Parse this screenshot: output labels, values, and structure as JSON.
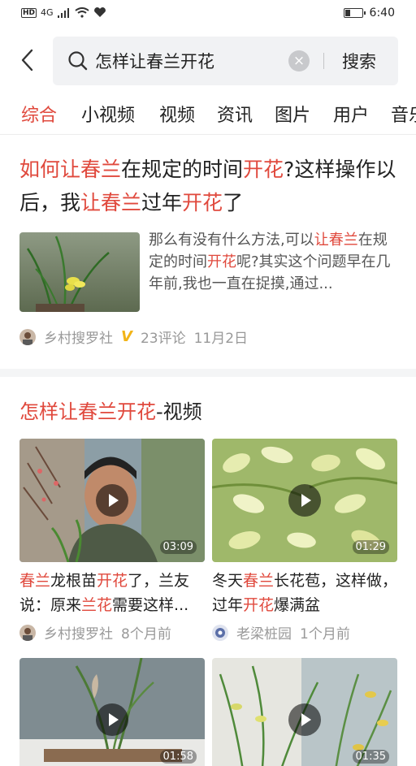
{
  "status_bar": {
    "network": "4G",
    "time": "6:40"
  },
  "search": {
    "query": "怎样让春兰开花",
    "button": "搜索"
  },
  "tabs": [
    "综合",
    "小视频",
    "视频",
    "资讯",
    "图片",
    "用户",
    "音乐"
  ],
  "active_tab": "综合",
  "article": {
    "title_parts": [
      "如何让春兰",
      "在规定的时间",
      "开花",
      "?这样操作以后，我",
      "让春兰",
      "过年",
      "开花",
      "了"
    ],
    "snippet_parts": [
      "那么有没有什么方法,可以",
      "让春兰",
      "在规定的时间",
      "开花",
      "呢?其实这个问题早在几年前,我也一直在捉摸,通过..."
    ],
    "author": "乡村搜罗社",
    "verified_badge": "V",
    "comments": "23评论",
    "date": "11月2日"
  },
  "video_section": {
    "title_highlight": "怎样让春兰开花",
    "title_suffix": "-视频",
    "videos": [
      {
        "title_parts": [
          "春兰",
          "龙根苗",
          "开花",
          "了，兰友说：原来",
          "兰花",
          "需要这样..."
        ],
        "duration": "03:09",
        "author": "乡村搜罗社",
        "time": "8个月前"
      },
      {
        "title_parts": [
          "冬天",
          "春兰",
          "长花苞，这样做，过年",
          "开花",
          "爆满盆"
        ],
        "duration": "01:29",
        "author": "老梁桩园",
        "time": "1个月前"
      },
      {
        "duration": "01:58"
      },
      {
        "duration": "01:35"
      }
    ]
  },
  "colors": {
    "accent": "#e0493d",
    "meta_text": "#999999",
    "verified": "#f2b418"
  }
}
